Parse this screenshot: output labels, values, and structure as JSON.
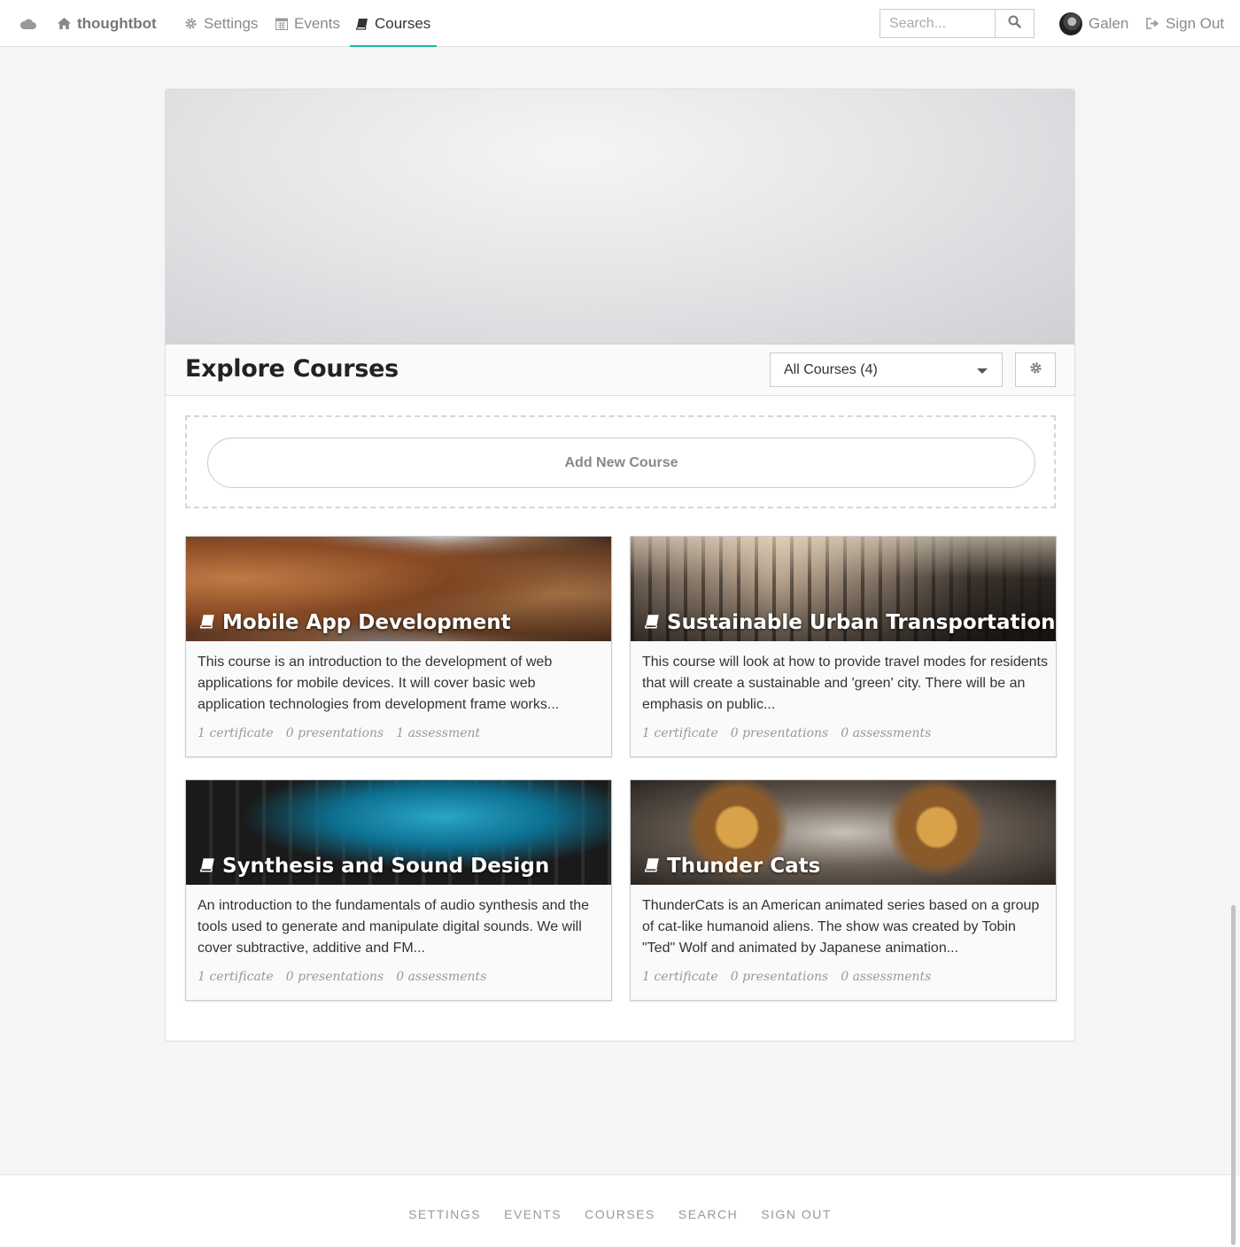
{
  "nav": {
    "cloud_icon": "cloud-icon",
    "brand": "thoughtbot",
    "items": [
      {
        "label": "Settings",
        "icon": "gear-icon"
      },
      {
        "label": "Events",
        "icon": "calendar-icon"
      },
      {
        "label": "Courses",
        "icon": "book-icon",
        "active": true
      }
    ],
    "search_placeholder": "Search...",
    "user_name": "Galen",
    "sign_out": "Sign Out"
  },
  "explore": {
    "title": "Explore Courses",
    "filter_selected": "All Courses (4)",
    "add_course": "Add New Course"
  },
  "courses": [
    {
      "title": "Mobile App Development",
      "description": "This course is an introduction to the development of web applications for mobile devices. It will cover basic web application technologies from development frame works...",
      "certificates": "1 certificate",
      "presentations": "0 presentations",
      "assessments": "1 assessment"
    },
    {
      "title": "Sustainable Urban Transportation",
      "description": "This course will look at how to provide travel modes for residents that will create a sustainable and 'green' city. There will be an emphasis on public...",
      "certificates": "1 certificate",
      "presentations": "0 presentations",
      "assessments": "0 assessments"
    },
    {
      "title": "Synthesis and Sound Design",
      "description": "An introduction to the fundamentals of audio synthesis and the tools used to generate and manipulate digital sounds. We will cover subtractive, additive and FM...",
      "certificates": "1 certificate",
      "presentations": "0 presentations",
      "assessments": "0 assessments"
    },
    {
      "title": "Thunder Cats",
      "description": "ThunderCats is an American animated series based on a group of cat-like humanoid aliens. The show was created by Tobin \"Ted\" Wolf and animated by Japanese animation...",
      "certificates": "1 certificate",
      "presentations": "0 presentations",
      "assessments": "0 assessments"
    }
  ],
  "footer": {
    "links": [
      "SETTINGS",
      "EVENTS",
      "COURSES",
      "SEARCH",
      "SIGN OUT"
    ]
  },
  "colors": {
    "accent": "#1abc9c",
    "page_bg": "#f5f5f5"
  }
}
